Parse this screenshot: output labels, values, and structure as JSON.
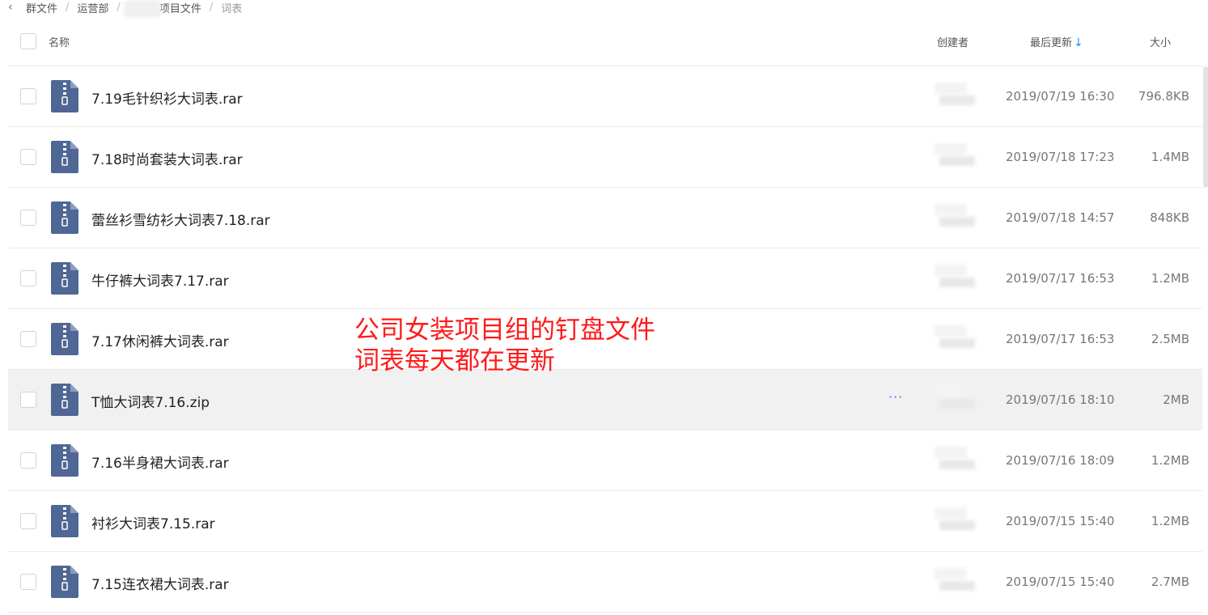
{
  "breadcrumb": {
    "back_icon": "chevron-left-icon",
    "items": [
      "群文件",
      "运营部",
      "项目文件",
      "词表"
    ]
  },
  "columns": {
    "name": "名称",
    "creator": "创建者",
    "updated": "最后更新",
    "size": "大小",
    "sort_icon": "arrow-down-icon"
  },
  "files": [
    {
      "name": "7.19毛针织衫大词表.rar",
      "date": "2019/07/19 16:30",
      "size": "796.8KB"
    },
    {
      "name": "7.18时尚套装大词表.rar",
      "date": "2019/07/18 17:23",
      "size": "1.4MB"
    },
    {
      "name": "蕾丝衫雪纺衫大词表7.18.rar",
      "date": "2019/07/18 14:57",
      "size": "848KB"
    },
    {
      "name": "牛仔裤大词表7.17.rar",
      "date": "2019/07/17 16:53",
      "size": "1.2MB"
    },
    {
      "name": "7.17休闲裤大词表.rar",
      "date": "2019/07/17 16:53",
      "size": "2.5MB"
    },
    {
      "name": "T恤大词表7.16.zip",
      "date": "2019/07/16 18:10",
      "size": "2MB"
    },
    {
      "name": "7.16半身裙大词表.rar",
      "date": "2019/07/16 18:09",
      "size": "1.2MB"
    },
    {
      "name": "衬衫大词表7.15.rar",
      "date": "2019/07/15 15:40",
      "size": "1.2MB"
    },
    {
      "name": "7.15连衣裙大词表.rar",
      "date": "2019/07/15 15:40",
      "size": "2.7MB"
    }
  ],
  "more_label": "···",
  "annotation": {
    "line1": "公司女装项目组的钉盘文件",
    "line2": "词表每天都在更新",
    "color": "#ff1a1a"
  },
  "colors": {
    "file_icon": "#4f6795",
    "accent": "#1a8cff",
    "hover_row": "#f1f1f1"
  }
}
